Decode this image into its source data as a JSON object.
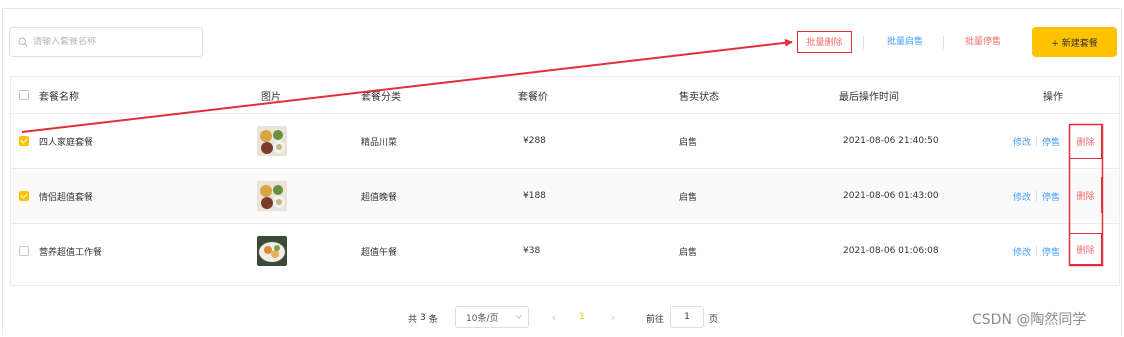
{
  "toolbar": {
    "search_placeholder": "请输入套餐名称",
    "batch_delete": "批量删除",
    "batch_enable": "批量启售",
    "batch_disable": "批量停售",
    "new_combo": "+ 新建套餐"
  },
  "table": {
    "headers": {
      "name": "套餐名称",
      "image": "图片",
      "category": "套餐分类",
      "price": "套餐价",
      "status": "售卖状态",
      "updated": "最后操作时间",
      "actions": "操作"
    },
    "rows": [
      {
        "checked": true,
        "name": "四人家庭套餐",
        "image": "dish-photo",
        "category": "精品川菜",
        "price": "¥288",
        "status": "启售",
        "updated": "2021-08-06 21:40:50"
      },
      {
        "checked": true,
        "name": "情侣超值套餐",
        "image": "dish-photo",
        "category": "超值晚餐",
        "price": "¥188",
        "status": "启售",
        "updated": "2021-08-06 01:43:00"
      },
      {
        "checked": false,
        "name": "营养超值工作餐",
        "image": "dish-photo",
        "category": "超值午餐",
        "price": "¥38",
        "status": "启售",
        "updated": "2021-08-06 01:06:08"
      }
    ],
    "row_actions": {
      "edit": "修改",
      "stop": "停售",
      "delete": "删除"
    }
  },
  "pagination": {
    "total_prefix": "共",
    "total": "3",
    "total_suffix": "条",
    "page_size": "10条/页",
    "current_page": "1",
    "goto_label": "前往",
    "goto_value": "1",
    "goto_suffix": "页"
  },
  "watermark": "CSDN @陶然同学",
  "colors": {
    "accent": "#ffc200",
    "link_blue": "#409eff",
    "danger": "#f56c6c",
    "annotation_red": "#e0303b"
  },
  "icons": [
    "search-icon",
    "chevron-down-icon",
    "chevron-left-icon",
    "chevron-right-icon",
    "checkbox-icon",
    "arrow-annotation"
  ]
}
